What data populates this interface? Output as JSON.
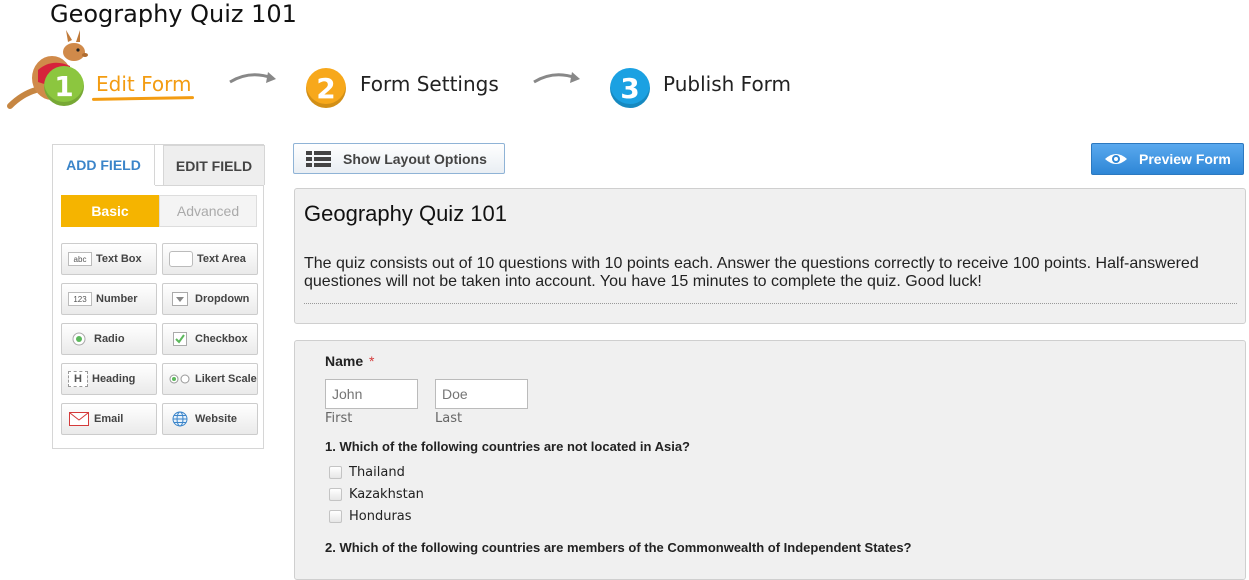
{
  "page": {
    "title": "Geography Quiz 101"
  },
  "wizard": {
    "steps": [
      {
        "number": "1",
        "label": "Edit Form",
        "color": "#8cc63f",
        "active": true
      },
      {
        "number": "2",
        "label": "Form Settings",
        "color": "#f7a81b",
        "active": false
      },
      {
        "number": "3",
        "label": "Publish Form",
        "color": "#1ba1e2",
        "active": false
      }
    ],
    "active_color": "#f39c12",
    "mascot_icon": "kangaroo-mascot"
  },
  "panel": {
    "tabs": {
      "add_field": "ADD FIELD",
      "edit_field": "EDIT FIELD"
    },
    "segments": {
      "basic": "Basic",
      "advanced": "Advanced"
    },
    "fields": [
      {
        "label": "Text Box",
        "icon": "abc"
      },
      {
        "label": "Text Area",
        "icon": ""
      },
      {
        "label": "Number",
        "icon": "123"
      },
      {
        "label": "Dropdown",
        "icon": "dropdown-icon"
      },
      {
        "label": "Radio",
        "icon": "radio-icon"
      },
      {
        "label": "Checkbox",
        "icon": "checkbox-icon"
      },
      {
        "label": "Heading",
        "icon": "H"
      },
      {
        "label": "Likert Scale",
        "icon": "likert-icon"
      },
      {
        "label": "Email",
        "icon": "email-icon"
      },
      {
        "label": "Website",
        "icon": "globe-icon"
      }
    ]
  },
  "toolbar": {
    "layout_label": "Show Layout Options",
    "preview_label": "Preview Form",
    "preview_color": "#2e86d6"
  },
  "form": {
    "title": "Geography Quiz 101",
    "description": "The quiz consists out of 10 questions with 10 points each. Answer the questions correctly to receive 100 points. Half-answered questiones will not be taken into account. You have 15 minutes to complete the quiz. Good luck!",
    "name_field": {
      "label": "Name",
      "required_mark": "*",
      "first_placeholder": "John",
      "last_placeholder": "Doe",
      "first_sublabel": "First",
      "last_sublabel": "Last"
    },
    "questions": [
      {
        "text": "1. Which of the following countries are not located in Asia?",
        "options": [
          "Thailand",
          "Kazakhstan",
          "Honduras"
        ]
      },
      {
        "text": "2. Which of the following countries are members of the Commonwealth of Independent States?",
        "options": []
      }
    ]
  }
}
